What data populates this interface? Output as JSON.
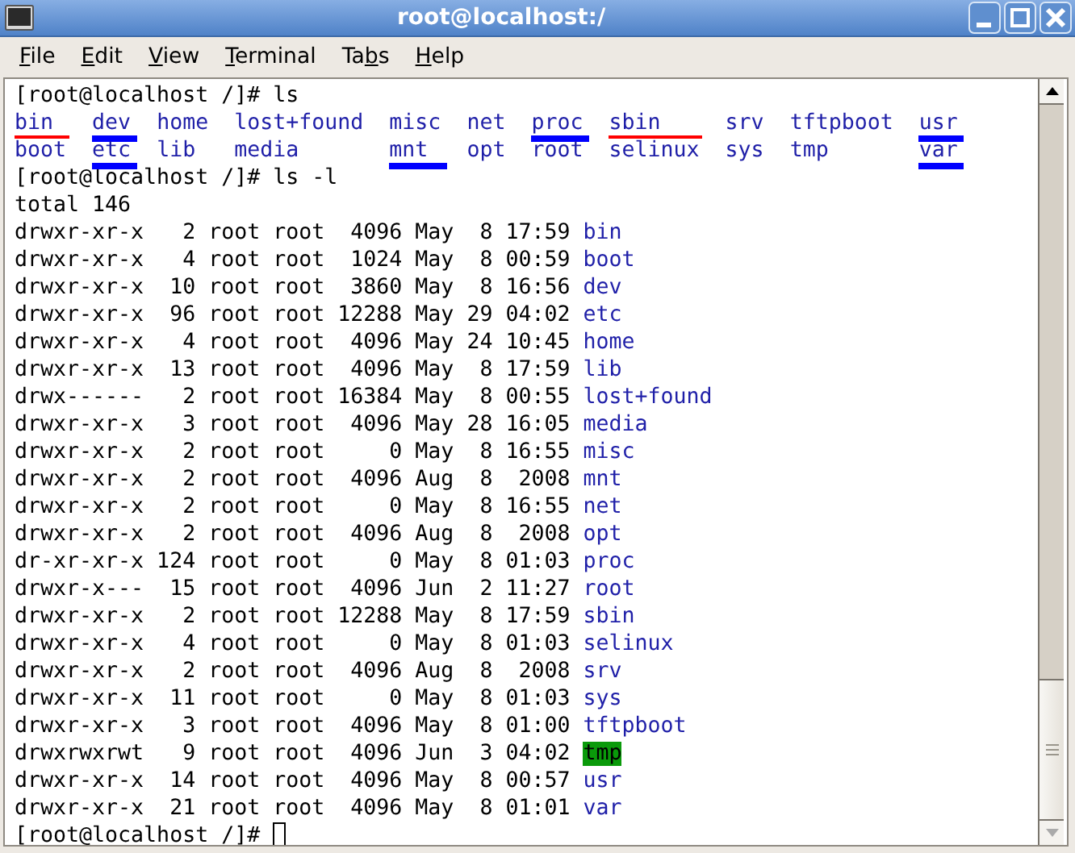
{
  "window": {
    "title": "root@localhost:/"
  },
  "menu": [
    {
      "key": "F",
      "after": "ile"
    },
    {
      "key": "E",
      "after": "dit"
    },
    {
      "key": "V",
      "after": "iew"
    },
    {
      "key": "T",
      "after": "erminal"
    },
    {
      "before": "Ta",
      "key": "b",
      "after": "s"
    },
    {
      "key": "H",
      "after": "elp"
    }
  ],
  "terminal": {
    "prompt_1": "[root@localhost /]# ls",
    "ls_entries": [
      {
        "name": "bin",
        "color": "#ff0000"
      },
      {
        "name": "boot"
      },
      {
        "name": "dev",
        "color": "#0000ff"
      },
      {
        "name": "etc",
        "color": "#0000ff"
      },
      {
        "name": "home"
      },
      {
        "name": "lib"
      },
      {
        "name": "lost+found"
      },
      {
        "name": "media"
      },
      {
        "name": "misc"
      },
      {
        "name": "mnt",
        "color": "#0000ff"
      },
      {
        "name": "net"
      },
      {
        "name": "opt"
      },
      {
        "name": "proc",
        "color": "#0000ff"
      },
      {
        "name": "root"
      },
      {
        "name": "sbin",
        "color": "#ff0000"
      },
      {
        "name": "selinux"
      },
      {
        "name": "srv"
      },
      {
        "name": "sys"
      },
      {
        "name": "tftpboot"
      },
      {
        "name": "tmp"
      },
      {
        "name": "usr",
        "color": "#0000ff"
      },
      {
        "name": "var",
        "color": "#0000ff"
      }
    ],
    "prompt_2": "[root@localhost /]# ls -l",
    "total": "total 146",
    "listing": [
      {
        "info": "drwxr-xr-x   2 root root  4096 May  8 17:59",
        "name": "bin",
        "kind": "dir"
      },
      {
        "info": "drwxr-xr-x   4 root root  1024 May  8 00:59",
        "name": "boot",
        "kind": "dir"
      },
      {
        "info": "drwxr-xr-x  10 root root  3860 May  8 16:56",
        "name": "dev",
        "kind": "dir"
      },
      {
        "info": "drwxr-xr-x  96 root root 12288 May 29 04:02",
        "name": "etc",
        "kind": "dir"
      },
      {
        "info": "drwxr-xr-x   4 root root  4096 May 24 10:45",
        "name": "home",
        "kind": "dir"
      },
      {
        "info": "drwxr-xr-x  13 root root  4096 May  8 17:59",
        "name": "lib",
        "kind": "dir"
      },
      {
        "info": "drwx------   2 root root 16384 May  8 00:55",
        "name": "lost+found",
        "kind": "dir"
      },
      {
        "info": "drwxr-xr-x   3 root root  4096 May 28 16:05",
        "name": "media",
        "kind": "dir"
      },
      {
        "info": "drwxr-xr-x   2 root root     0 May  8 16:55",
        "name": "misc",
        "kind": "dir"
      },
      {
        "info": "drwxr-xr-x   2 root root  4096 Aug  8  2008",
        "name": "mnt",
        "kind": "dir"
      },
      {
        "info": "drwxr-xr-x   2 root root     0 May  8 16:55",
        "name": "net",
        "kind": "dir"
      },
      {
        "info": "drwxr-xr-x   2 root root  4096 Aug  8  2008",
        "name": "opt",
        "kind": "dir"
      },
      {
        "info": "dr-xr-xr-x 124 root root     0 May  8 01:03",
        "name": "proc",
        "kind": "dir"
      },
      {
        "info": "drwxr-x---  15 root root  4096 Jun  2 11:27",
        "name": "root",
        "kind": "dir"
      },
      {
        "info": "drwxr-xr-x   2 root root 12288 May  8 17:59",
        "name": "sbin",
        "kind": "dir"
      },
      {
        "info": "drwxr-xr-x   4 root root     0 May  8 01:03",
        "name": "selinux",
        "kind": "dir"
      },
      {
        "info": "drwxr-xr-x   2 root root  4096 Aug  8  2008",
        "name": "srv",
        "kind": "dir"
      },
      {
        "info": "drwxr-xr-x  11 root root     0 May  8 01:03",
        "name": "sys",
        "kind": "dir"
      },
      {
        "info": "drwxr-xr-x   3 root root  4096 May  8 01:00",
        "name": "tftpboot",
        "kind": "dir"
      },
      {
        "info": "drwxrwxrwt   9 root root  4096 Jun  3 04:02",
        "name": "tmp",
        "kind": "sticky"
      },
      {
        "info": "drwxr-xr-x  14 root root  4096 May  8 00:57",
        "name": "usr",
        "kind": "dir"
      },
      {
        "info": "drwxr-xr-x  21 root root  4096 May  8 01:01",
        "name": "var",
        "kind": "dir"
      }
    ],
    "prompt_3": "[root@localhost /]#"
  }
}
